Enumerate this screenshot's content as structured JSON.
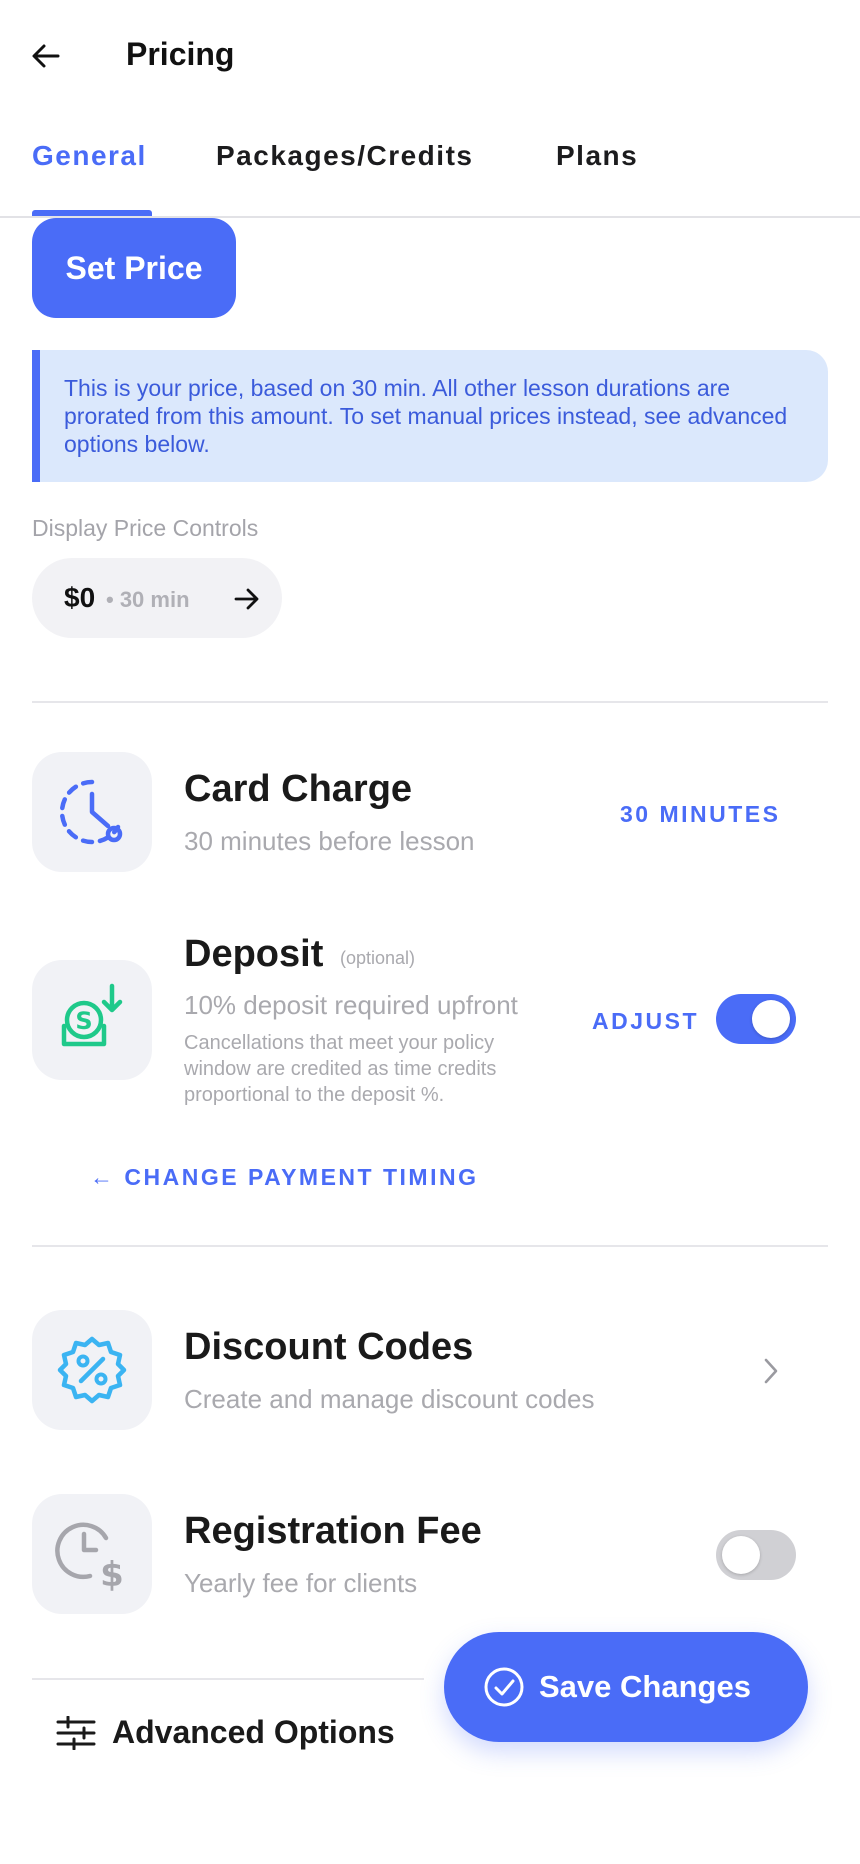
{
  "header": {
    "title": "Pricing",
    "back_icon": "arrow-left-icon"
  },
  "tabs": [
    {
      "label": "General",
      "active": true
    },
    {
      "label": "Packages/Credits",
      "active": false
    },
    {
      "label": "Plans",
      "active": false
    }
  ],
  "set_price": {
    "label": "Set Price"
  },
  "info_box": {
    "text": "This is your price, based on 30 min. All other lesson durations are prorated from this amount. To set manual prices instead, see advanced options below."
  },
  "display_price": {
    "label": "Display Price Controls",
    "price": "$0",
    "duration": "• 30 min"
  },
  "card_charge": {
    "title": "Card Charge",
    "subtitle": "30 minutes before lesson",
    "value": "30 MINUTES",
    "icon": "clock-timer-icon"
  },
  "deposit": {
    "title": "Deposit",
    "optional": "(optional)",
    "subtitle": "10% deposit required upfront",
    "note": "Cancellations that meet your policy window are credited as time credits proportional to the deposit %.",
    "adjust_label": "ADJUST",
    "enabled": true,
    "icon": "deposit-coin-icon"
  },
  "change_timing": {
    "label": "← CHANGE PAYMENT TIMING"
  },
  "discount_codes": {
    "title": "Discount Codes",
    "subtitle": "Create and manage discount codes",
    "icon": "percent-badge-icon"
  },
  "registration_fee": {
    "title": "Registration Fee",
    "subtitle": "Yearly fee for clients",
    "enabled": false,
    "icon": "clock-dollar-icon"
  },
  "advanced_options": {
    "label": "Advanced Options",
    "icon": "sliders-icon"
  },
  "save_button": {
    "label": "Save Changes",
    "icon": "check-circle-icon"
  },
  "colors": {
    "accent": "#4a6cf7",
    "info_bg": "#dbe8fc",
    "deposit_icon": "#1fc98a",
    "discount_icon": "#3bb4f2"
  }
}
